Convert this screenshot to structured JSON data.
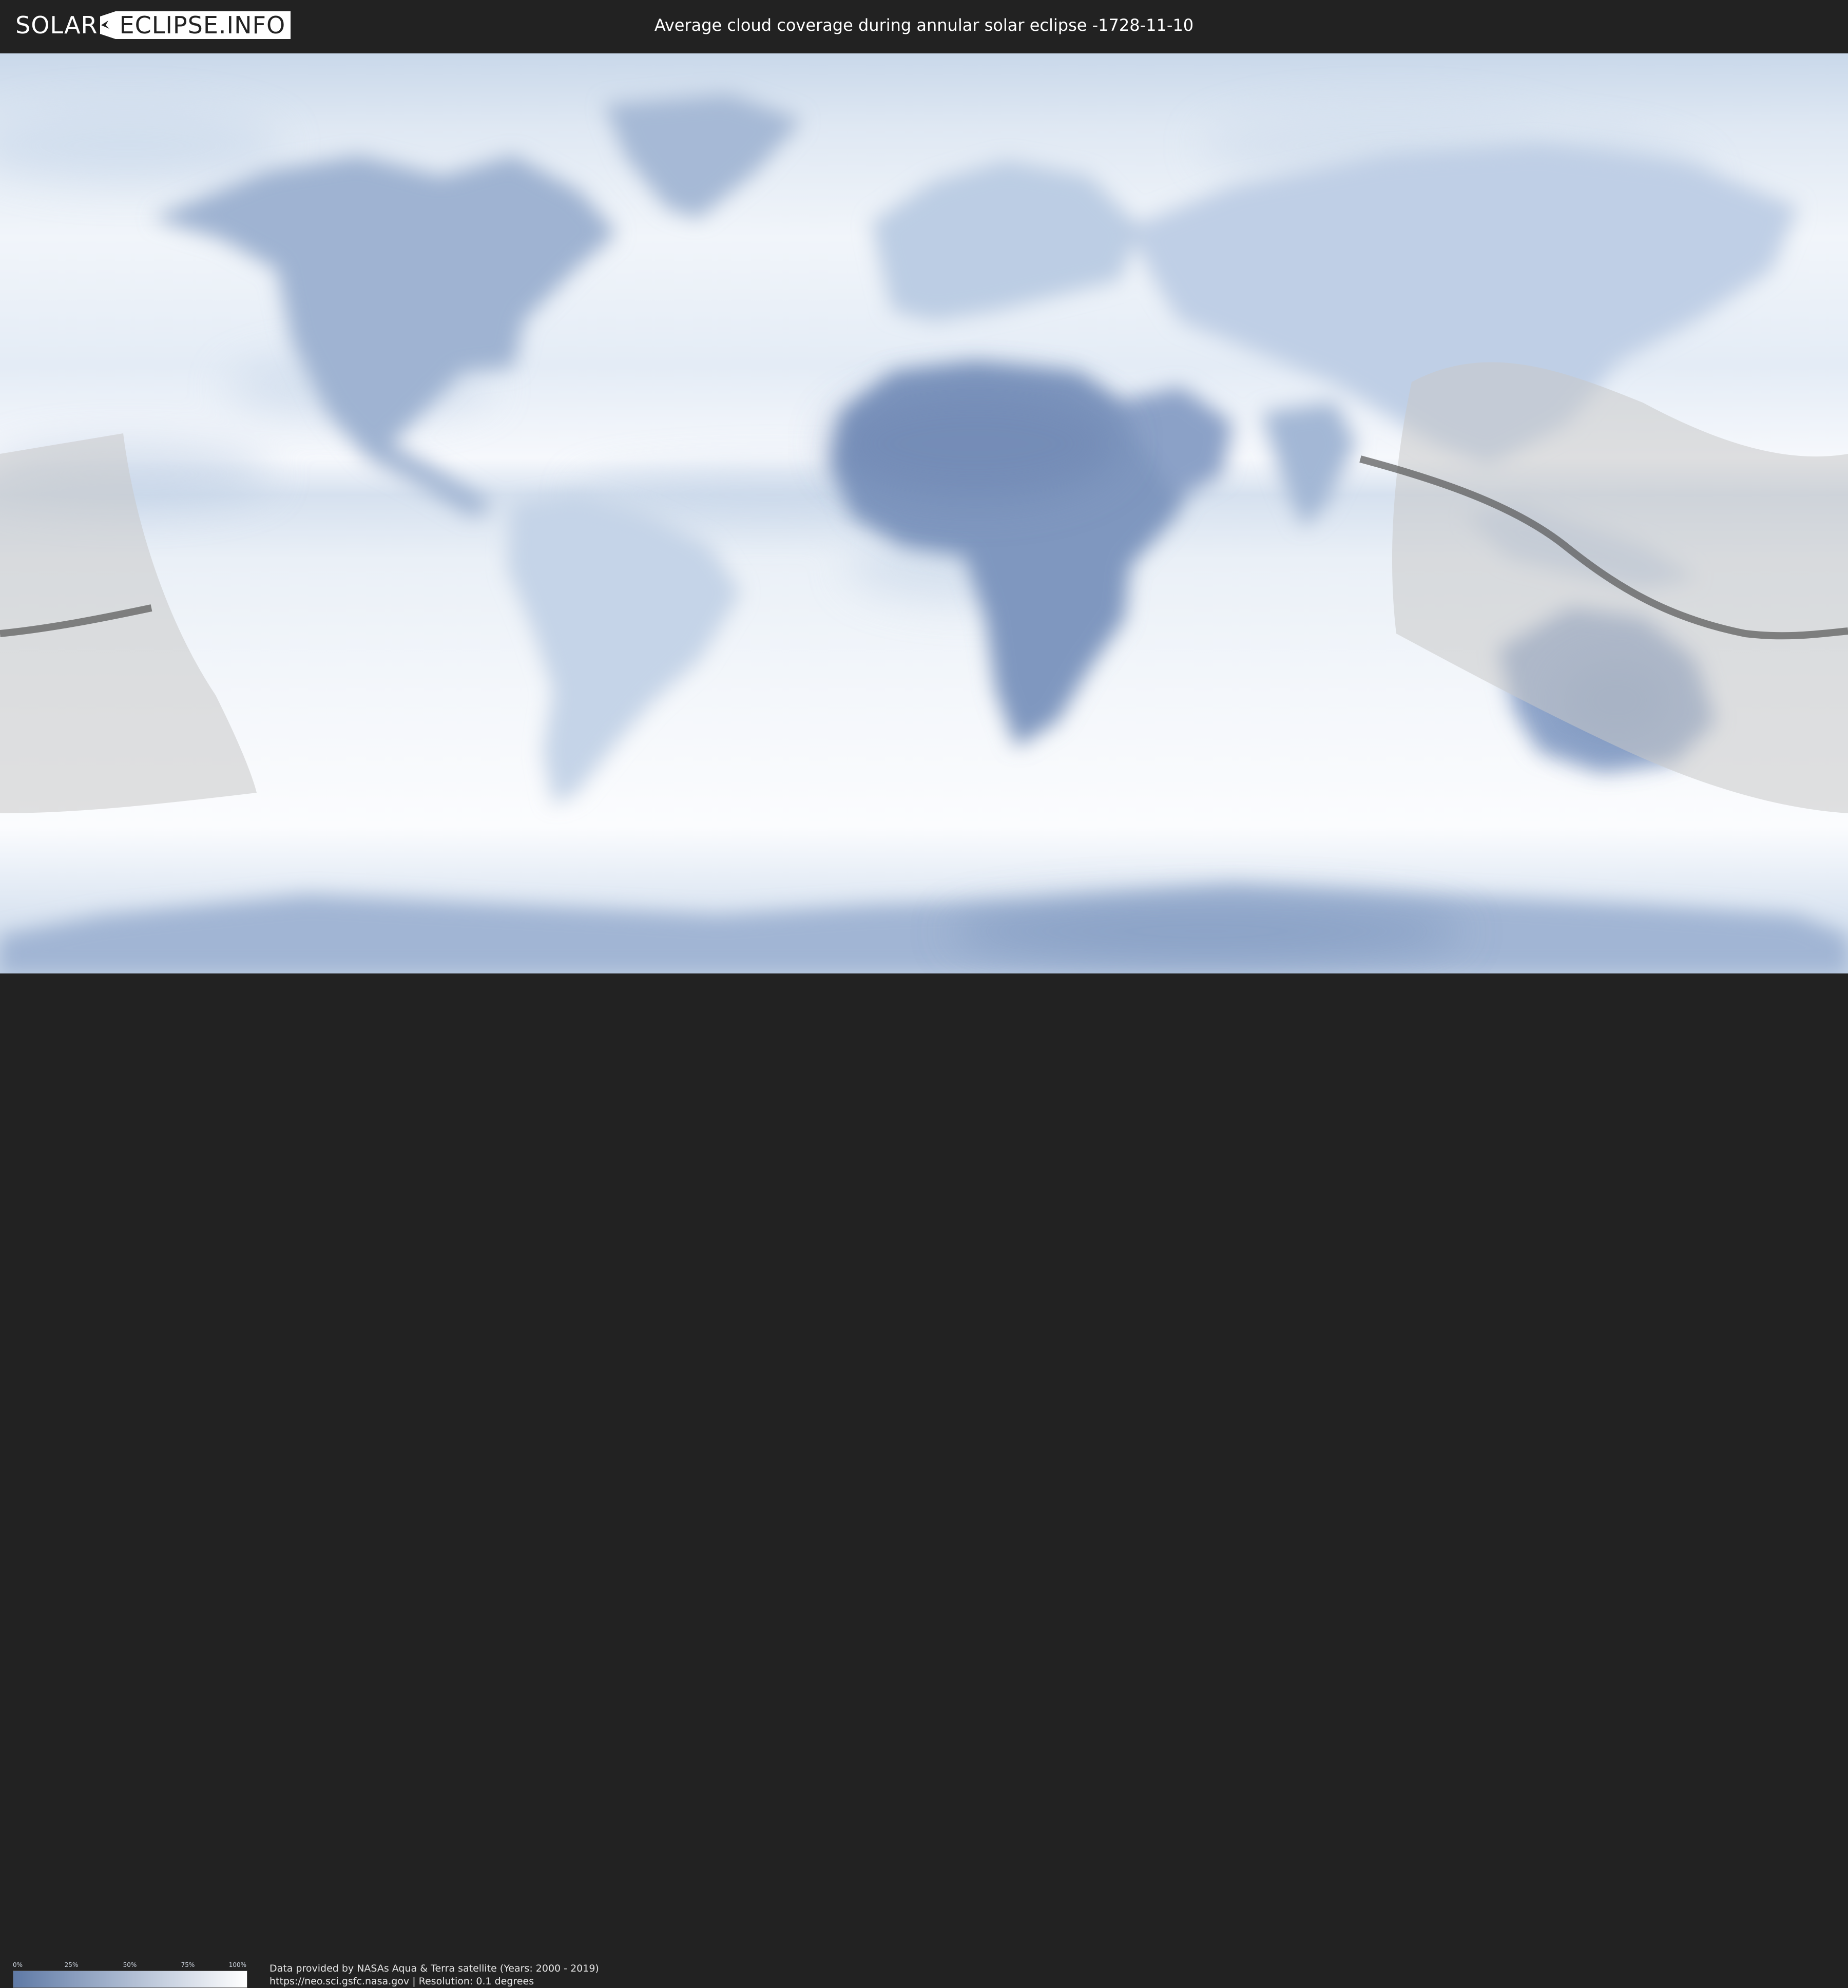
{
  "header": {
    "logo_left": "SOLAR",
    "logo_right": "ECLIPSE.INFO",
    "title": "Average cloud coverage during annular solar eclipse -1728-11-10"
  },
  "map": {
    "description_layer": "cloud-coverage",
    "colors": {
      "clear": "#5f7aa6",
      "cloudy": "#ffffff",
      "eclipse_zone": "#c8c8c8",
      "eclipse_path": "#555555",
      "borders": "#4a5568"
    }
  },
  "legend": {
    "ticks": [
      "0%",
      "25%",
      "50%",
      "75%",
      "100%"
    ],
    "gradient_start": "#5f7aa6",
    "gradient_end": "#ffffff"
  },
  "credits": {
    "line1": "Data provided by NASAs Aqua & Terra satellite (Years: 2000 - 2019)",
    "line2": "https://neo.sci.gsfc.nasa.gov | Resolution: 0.1 degrees"
  }
}
